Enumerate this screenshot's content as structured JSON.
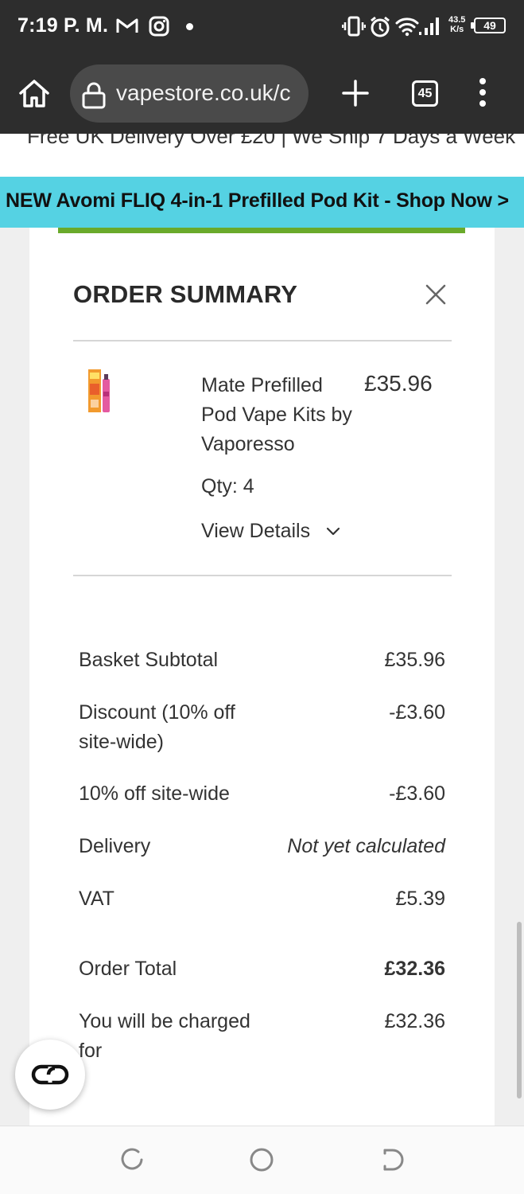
{
  "status_bar": {
    "time": "7:19 P. M.",
    "net_speed_value": "43.5",
    "net_speed_unit": "K/s",
    "battery": "49",
    "icons": [
      "gmail-icon",
      "instagram-icon",
      "vibrate-icon",
      "alarm-icon",
      "wifi-icon",
      "signal-icon",
      "battery-icon"
    ]
  },
  "browser": {
    "url": "vapestore.co.uk/c",
    "tab_count": "45",
    "icons": [
      "home-icon",
      "lock-icon",
      "plus-icon",
      "tabs-icon",
      "menu-icon"
    ]
  },
  "delivery_strip": "Free UK Delivery Over £20  |  We Ship 7 Days a Week",
  "banner": "NEW Avomi FLIQ 4-in-1 Prefilled Pod Kit - Shop Now >",
  "order_summary": {
    "title": "ORDER SUMMARY",
    "item": {
      "name": "Mate Prefilled Pod Vape Kits by Vaporesso",
      "price": "£35.96",
      "qty": "Qty: 4",
      "view_details": "View Details"
    },
    "totals": {
      "subtotal_label": "Basket Subtotal",
      "subtotal_value": "£35.96",
      "discount_label": "Discount (10% off site-wide)",
      "discount_value": "-£3.60",
      "sitewide_label": "10% off site-wide",
      "sitewide_value": "-£3.60",
      "delivery_label": "Delivery",
      "delivery_value": "Not yet calculated",
      "vat_label": "VAT",
      "vat_value": "£5.39",
      "order_total_label": "Order Total",
      "order_total_value": "£32.36",
      "charged_label": "You will be charged for",
      "charged_value": "£32.36"
    }
  },
  "colors": {
    "banner": "#55d2e3",
    "accent_green": "#6aaa2b",
    "status_bar": "#2d2d2d"
  }
}
